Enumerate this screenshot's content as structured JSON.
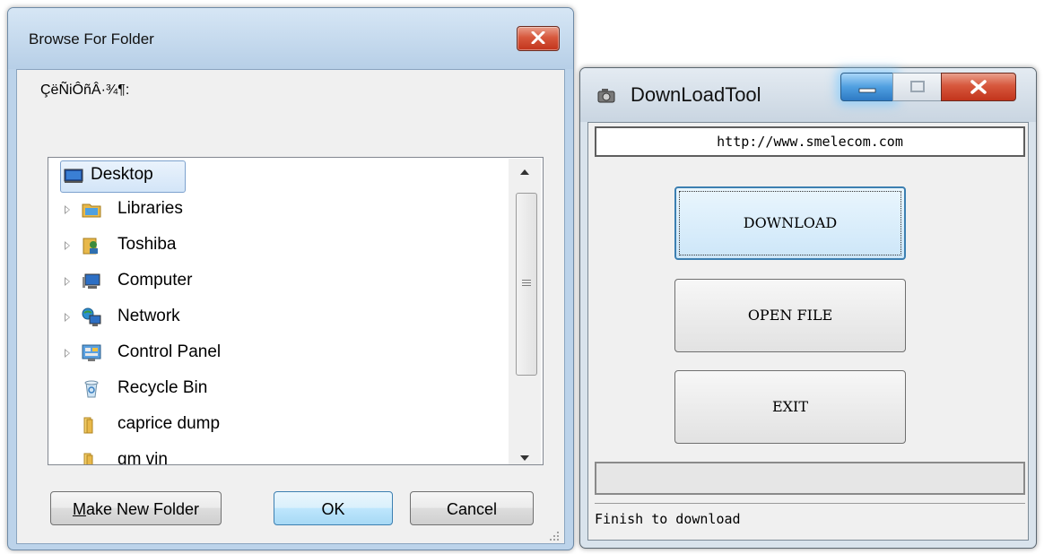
{
  "browse_dialog": {
    "title": "Browse For Folder",
    "description": "ÇëÑiÔñÂ·¾¶:",
    "tree_items": [
      {
        "label": "Desktop",
        "icon": "desktop-icon",
        "expandable": false,
        "selected": true
      },
      {
        "label": "Libraries",
        "icon": "libraries-icon",
        "expandable": true,
        "selected": false
      },
      {
        "label": "Toshiba",
        "icon": "user-folder-icon",
        "expandable": true,
        "selected": false
      },
      {
        "label": "Computer",
        "icon": "computer-icon",
        "expandable": true,
        "selected": false
      },
      {
        "label": "Network",
        "icon": "network-icon",
        "expandable": true,
        "selected": false
      },
      {
        "label": "Control Panel",
        "icon": "control-panel-icon",
        "expandable": true,
        "selected": false
      },
      {
        "label": "Recycle Bin",
        "icon": "recycle-bin-icon",
        "expandable": false,
        "selected": false
      },
      {
        "label": "caprice dump",
        "icon": "folder-icon",
        "expandable": false,
        "selected": false
      },
      {
        "label": "gm vin",
        "icon": "folder-icon",
        "expandable": false,
        "selected": false
      }
    ],
    "buttons": {
      "make_new_folder_prefix": "M",
      "make_new_folder_rest": "ake New Folder",
      "ok": "OK",
      "cancel": "Cancel"
    }
  },
  "download_tool": {
    "title": "DownLoadTool",
    "url": "http://www.smelecom.com",
    "buttons": {
      "download": "DOWNLOAD",
      "open_file": "OPEN FILE",
      "exit": "EXIT"
    },
    "progress_fraction": 0,
    "status": "Finish to download"
  },
  "colors": {
    "selection_border": "#7da2ce",
    "close_red": "#c2341c",
    "default_button_blue": "#3c7fb1",
    "folder_yellow": "#e8b84a"
  }
}
